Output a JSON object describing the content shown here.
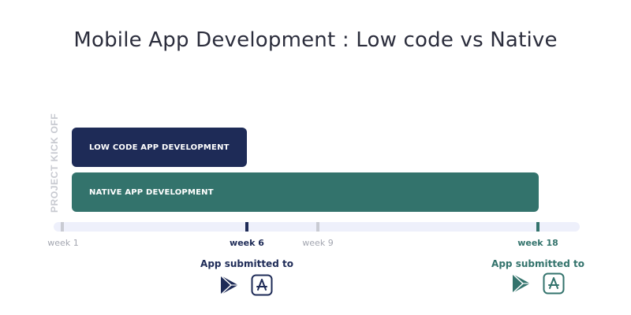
{
  "title": "Mobile App Development : Low code vs Native",
  "kickoff_label": "PROJECT KICK OFF",
  "bars": {
    "low_code": "LOW CODE APP DEVELOPMENT",
    "native": "NATIVE APP DEVELOPMENT"
  },
  "timeline": {
    "week1": "week 1",
    "week6": "week 6",
    "week9": "week 9",
    "week18": "week 18"
  },
  "submissions": {
    "low_code": "App submitted to",
    "native": "App submitted to"
  },
  "icons": {
    "store_play": "google-play-icon",
    "store_apple": "app-store-icon"
  },
  "colors": {
    "low_code": "#1e2b57",
    "native": "#33736c",
    "track": "#eef0fb",
    "muted": "#a3a6b0"
  }
}
